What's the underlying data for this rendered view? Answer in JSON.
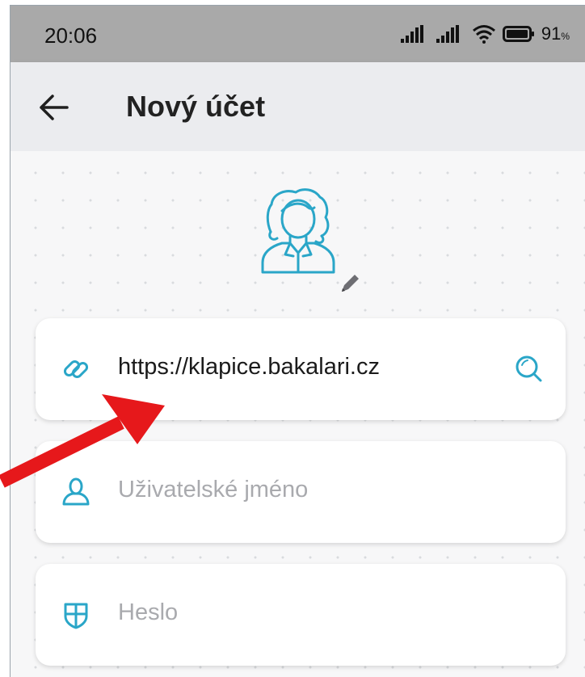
{
  "status_bar": {
    "time": "20:06",
    "battery": "91",
    "battery_unit": "%",
    "icons": [
      "signal-icon",
      "signal-icon",
      "wifi-icon",
      "battery-icon"
    ]
  },
  "app_bar": {
    "title": "Nový účet",
    "back_icon": "arrow-left-icon"
  },
  "avatar": {
    "icon": "woman-avatar-icon",
    "edit_icon": "pencil-icon"
  },
  "form": {
    "server": {
      "value": "https://klapice.bakalari.cz",
      "icon": "link-icon",
      "action_icon": "search-icon"
    },
    "username": {
      "placeholder": "Uživatelské jméno",
      "value": "",
      "icon": "user-icon"
    },
    "password": {
      "placeholder": "Heslo",
      "value": "",
      "icon": "shield-icon"
    }
  },
  "colors": {
    "accent": "#2aa6c8",
    "status_bar": "#a9a9a9",
    "app_bar": "#ebecef",
    "annotation_arrow": "#e6181b"
  }
}
